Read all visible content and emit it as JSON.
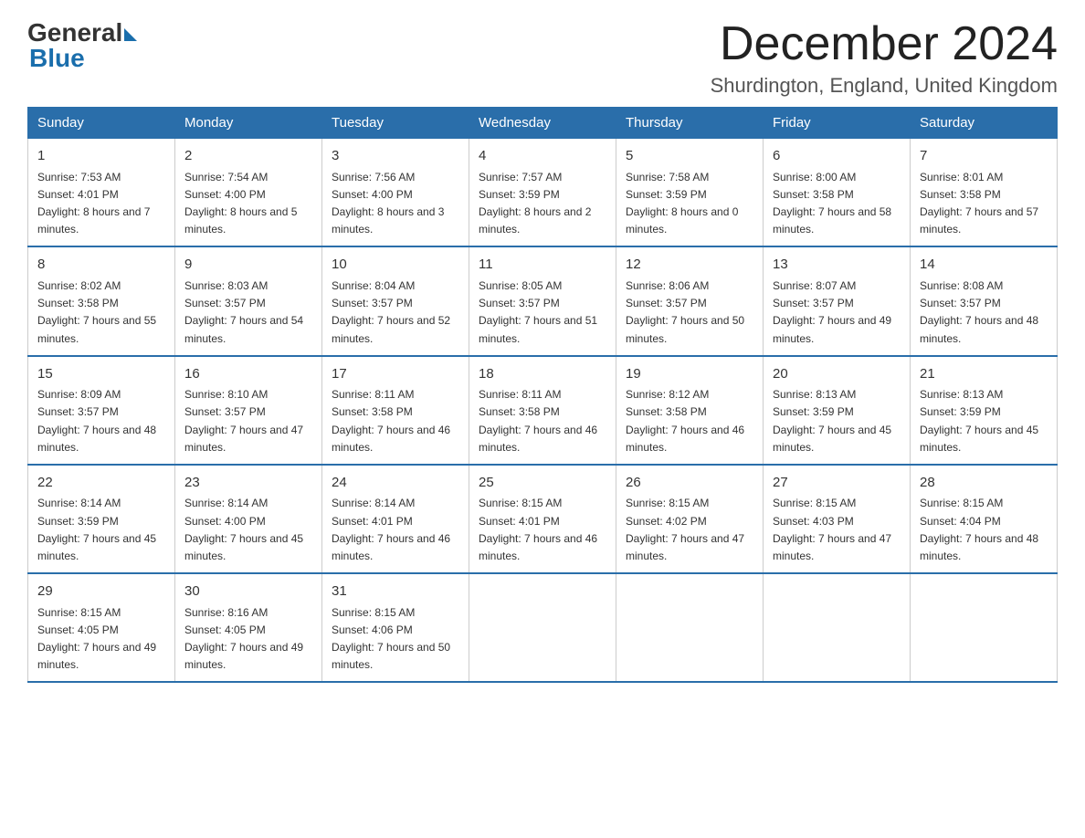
{
  "logo": {
    "general": "General",
    "blue": "Blue"
  },
  "title": "December 2024",
  "location": "Shurdington, England, United Kingdom",
  "headers": [
    "Sunday",
    "Monday",
    "Tuesday",
    "Wednesday",
    "Thursday",
    "Friday",
    "Saturday"
  ],
  "weeks": [
    [
      {
        "day": "1",
        "sunrise": "7:53 AM",
        "sunset": "4:01 PM",
        "daylight": "8 hours and 7 minutes."
      },
      {
        "day": "2",
        "sunrise": "7:54 AM",
        "sunset": "4:00 PM",
        "daylight": "8 hours and 5 minutes."
      },
      {
        "day": "3",
        "sunrise": "7:56 AM",
        "sunset": "4:00 PM",
        "daylight": "8 hours and 3 minutes."
      },
      {
        "day": "4",
        "sunrise": "7:57 AM",
        "sunset": "3:59 PM",
        "daylight": "8 hours and 2 minutes."
      },
      {
        "day": "5",
        "sunrise": "7:58 AM",
        "sunset": "3:59 PM",
        "daylight": "8 hours and 0 minutes."
      },
      {
        "day": "6",
        "sunrise": "8:00 AM",
        "sunset": "3:58 PM",
        "daylight": "7 hours and 58 minutes."
      },
      {
        "day": "7",
        "sunrise": "8:01 AM",
        "sunset": "3:58 PM",
        "daylight": "7 hours and 57 minutes."
      }
    ],
    [
      {
        "day": "8",
        "sunrise": "8:02 AM",
        "sunset": "3:58 PM",
        "daylight": "7 hours and 55 minutes."
      },
      {
        "day": "9",
        "sunrise": "8:03 AM",
        "sunset": "3:57 PM",
        "daylight": "7 hours and 54 minutes."
      },
      {
        "day": "10",
        "sunrise": "8:04 AM",
        "sunset": "3:57 PM",
        "daylight": "7 hours and 52 minutes."
      },
      {
        "day": "11",
        "sunrise": "8:05 AM",
        "sunset": "3:57 PM",
        "daylight": "7 hours and 51 minutes."
      },
      {
        "day": "12",
        "sunrise": "8:06 AM",
        "sunset": "3:57 PM",
        "daylight": "7 hours and 50 minutes."
      },
      {
        "day": "13",
        "sunrise": "8:07 AM",
        "sunset": "3:57 PM",
        "daylight": "7 hours and 49 minutes."
      },
      {
        "day": "14",
        "sunrise": "8:08 AM",
        "sunset": "3:57 PM",
        "daylight": "7 hours and 48 minutes."
      }
    ],
    [
      {
        "day": "15",
        "sunrise": "8:09 AM",
        "sunset": "3:57 PM",
        "daylight": "7 hours and 48 minutes."
      },
      {
        "day": "16",
        "sunrise": "8:10 AM",
        "sunset": "3:57 PM",
        "daylight": "7 hours and 47 minutes."
      },
      {
        "day": "17",
        "sunrise": "8:11 AM",
        "sunset": "3:58 PM",
        "daylight": "7 hours and 46 minutes."
      },
      {
        "day": "18",
        "sunrise": "8:11 AM",
        "sunset": "3:58 PM",
        "daylight": "7 hours and 46 minutes."
      },
      {
        "day": "19",
        "sunrise": "8:12 AM",
        "sunset": "3:58 PM",
        "daylight": "7 hours and 46 minutes."
      },
      {
        "day": "20",
        "sunrise": "8:13 AM",
        "sunset": "3:59 PM",
        "daylight": "7 hours and 45 minutes."
      },
      {
        "day": "21",
        "sunrise": "8:13 AM",
        "sunset": "3:59 PM",
        "daylight": "7 hours and 45 minutes."
      }
    ],
    [
      {
        "day": "22",
        "sunrise": "8:14 AM",
        "sunset": "3:59 PM",
        "daylight": "7 hours and 45 minutes."
      },
      {
        "day": "23",
        "sunrise": "8:14 AM",
        "sunset": "4:00 PM",
        "daylight": "7 hours and 45 minutes."
      },
      {
        "day": "24",
        "sunrise": "8:14 AM",
        "sunset": "4:01 PM",
        "daylight": "7 hours and 46 minutes."
      },
      {
        "day": "25",
        "sunrise": "8:15 AM",
        "sunset": "4:01 PM",
        "daylight": "7 hours and 46 minutes."
      },
      {
        "day": "26",
        "sunrise": "8:15 AM",
        "sunset": "4:02 PM",
        "daylight": "7 hours and 47 minutes."
      },
      {
        "day": "27",
        "sunrise": "8:15 AM",
        "sunset": "4:03 PM",
        "daylight": "7 hours and 47 minutes."
      },
      {
        "day": "28",
        "sunrise": "8:15 AM",
        "sunset": "4:04 PM",
        "daylight": "7 hours and 48 minutes."
      }
    ],
    [
      {
        "day": "29",
        "sunrise": "8:15 AM",
        "sunset": "4:05 PM",
        "daylight": "7 hours and 49 minutes."
      },
      {
        "day": "30",
        "sunrise": "8:16 AM",
        "sunset": "4:05 PM",
        "daylight": "7 hours and 49 minutes."
      },
      {
        "day": "31",
        "sunrise": "8:15 AM",
        "sunset": "4:06 PM",
        "daylight": "7 hours and 50 minutes."
      },
      null,
      null,
      null,
      null
    ]
  ]
}
